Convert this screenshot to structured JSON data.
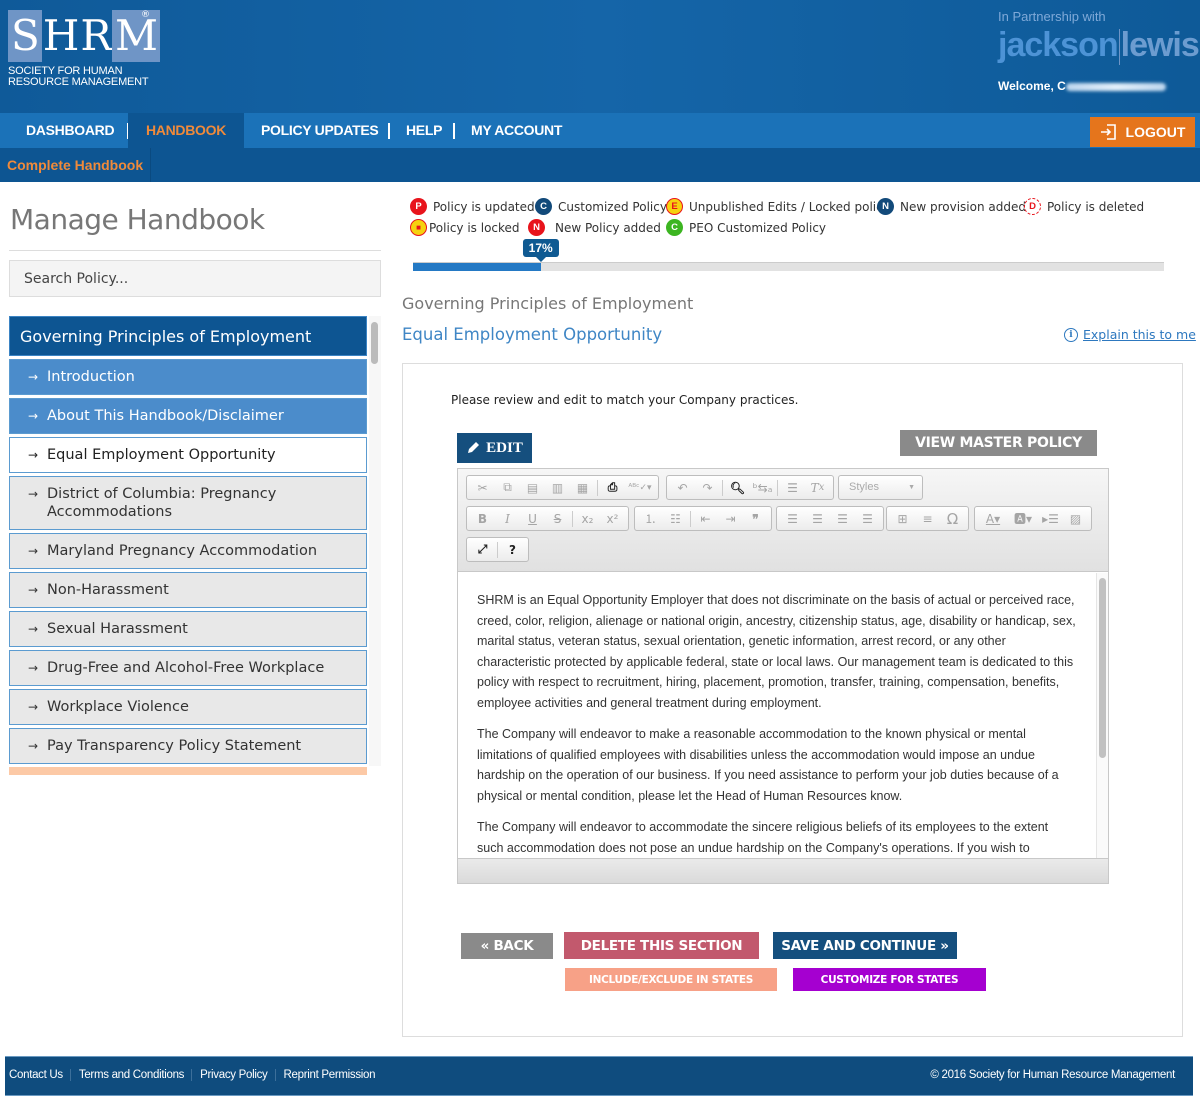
{
  "header": {
    "logo": {
      "letters": [
        "S",
        "H",
        "R",
        "M"
      ],
      "registered": "®",
      "line1": "SOCIETY FOR HUMAN",
      "line2": "RESOURCE MANAGEMENT"
    },
    "partnership": "In Partnership with",
    "partner_brand": {
      "part1": "jackson",
      "part2": "lewis"
    },
    "welcome": "Welcome, C"
  },
  "nav": {
    "items": [
      {
        "label": "DASHBOARD",
        "active": false
      },
      {
        "label": "HANDBOOK",
        "active": true
      },
      {
        "label": "POLICY UPDATES",
        "active": false
      },
      {
        "label": "HELP",
        "active": false
      },
      {
        "label": "MY ACCOUNT",
        "active": false
      }
    ],
    "logout": "LOGOUT",
    "subnav": "Complete Handbook"
  },
  "sidebar": {
    "title": "Manage Handbook",
    "search_placeholder": "Search Policy...",
    "section": "Governing Principles of Employment",
    "items": [
      {
        "label": "Introduction",
        "state": "done"
      },
      {
        "label": "About This Handbook/Disclaimer",
        "state": "done"
      },
      {
        "label": "Equal Employment Opportunity",
        "state": "current"
      },
      {
        "label": "District of Columbia: Pregnancy Accommodations",
        "state": "pending"
      },
      {
        "label": "Maryland Pregnancy Accommodation",
        "state": "pending"
      },
      {
        "label": "Non-Harassment",
        "state": "pending"
      },
      {
        "label": "Sexual Harassment",
        "state": "pending"
      },
      {
        "label": "Drug-Free and Alcohol-Free Workplace",
        "state": "pending"
      },
      {
        "label": "Workplace Violence",
        "state": "pending"
      },
      {
        "label": "Pay Transparency Policy Statement",
        "state": "pending"
      }
    ]
  },
  "legend": [
    {
      "letter": "P",
      "label": "Policy is updated",
      "color": "#e8141c"
    },
    {
      "letter": "C",
      "label": "Customized Policy",
      "color": "#124a7a"
    },
    {
      "letter": "E",
      "label": "Unpublished Edits / Locked policy",
      "color": "#f6d10f"
    },
    {
      "letter": "N",
      "label": "New provision added",
      "color": "#124a7a"
    },
    {
      "letter": "D",
      "label": "Policy is deleted",
      "color": "#ffffff"
    },
    {
      "letter": "🔒",
      "label": "Policy is locked",
      "color": "#f6d10f"
    },
    {
      "letter": "N",
      "label": "New Policy added",
      "color": "#e8141c"
    },
    {
      "letter": "C",
      "label": "PEO Customized Policy",
      "color": "#3cb521"
    }
  ],
  "progress": {
    "percent": 17,
    "label": "17%"
  },
  "content": {
    "section": "Governing Principles of Employment",
    "policy_title": "Equal Employment Opportunity",
    "explain": "Explain this to me",
    "instructions": "Please review and edit to match your Company practices.",
    "edit_label": "EDIT",
    "view_master": "VIEW MASTER POLICY",
    "styles_placeholder": "Styles",
    "paragraphs": [
      "SHRM is an Equal Opportunity Employer that does not discriminate on the basis of actual or perceived race, creed, color, religion, alienage or national origin, ancestry, citizenship status, age, disability or handicap, sex, marital status, veteran status, sexual orientation, genetic information, arrest record, or any other characteristic protected by applicable federal, state or local laws. Our management team is dedicated to this policy with respect to recruitment, hiring, placement, promotion, transfer, training, compensation, benefits, employee activities and general treatment during employment.",
      "The Company will endeavor to make a reasonable accommodation to the known physical or mental limitations of qualified employees with disabilities unless the accommodation would impose an undue hardship on the operation of our business. If you need assistance to perform your job duties because of a physical or mental condition, please let the Head of Human Resources know.",
      "The Company will endeavor to accommodate the sincere religious beliefs of its employees to the extent such accommodation does not pose an undue hardship on the Company's operations. If you wish to"
    ]
  },
  "actions": {
    "back": "« BACK",
    "delete": "DELETE THIS SECTION",
    "save": "SAVE AND CONTINUE »",
    "include_exclude": "INCLUDE/EXCLUDE IN STATES",
    "customize": "CUSTOMIZE FOR STATES"
  },
  "footer": {
    "links": [
      "Contact Us",
      "Terms and Conditions",
      "Privacy Policy",
      "Reprint Permission"
    ],
    "copyright": "© 2016 Society for Human Resource Management"
  }
}
